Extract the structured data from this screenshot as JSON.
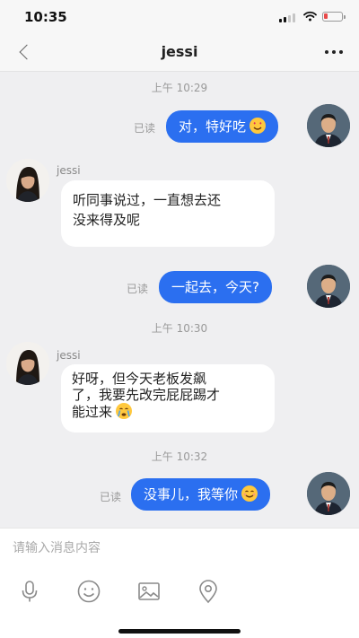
{
  "status_bar": {
    "time": "10:35"
  },
  "header": {
    "title": "jessi",
    "back_icon": "chevron-left-icon",
    "more_icon": "more-dots-icon"
  },
  "messages": [
    {
      "type": "timestamp",
      "text": "上午 10:29"
    },
    {
      "type": "outgoing",
      "text": "对，特好吃",
      "emoji": "heart-eyes-emoji",
      "read": "已读"
    },
    {
      "type": "incoming",
      "sender": "jessi",
      "lines": [
        "听同事说过，一直想去还",
        "没来得及呢"
      ]
    },
    {
      "type": "outgoing",
      "text": "一起去，今天?",
      "read": "已读"
    },
    {
      "type": "timestamp",
      "text": "上午 10:30"
    },
    {
      "type": "incoming",
      "sender": "jessi",
      "lines": [
        "好呀，但今天老板发飙",
        "了，我要先改完屁屁踢才",
        "能过来"
      ],
      "emoji": "crying-emoji"
    },
    {
      "type": "timestamp",
      "text": "上午 10:32"
    },
    {
      "type": "outgoing",
      "text": "没事儿，我等你",
      "emoji": "smile-emoji",
      "read": "已读"
    }
  ],
  "composer": {
    "placeholder": "请输入消息内容",
    "tools": [
      "microphone-icon",
      "emoji-icon",
      "image-icon",
      "location-icon"
    ]
  },
  "colors": {
    "outgoing_bubble": "#2b6ff0",
    "incoming_bubble": "#ffffff",
    "background": "#efeff1"
  }
}
